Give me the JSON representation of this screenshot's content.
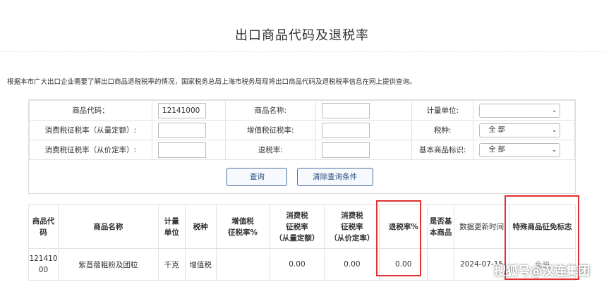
{
  "page": {
    "title": "出口商品代码及退税率",
    "intro": "根据本市广大出口企业需要了解出口商品退税税率的情况，国家税务总局上海市税务局现将出口商品代码及退税税率信息在网上提供查询。"
  },
  "form": {
    "code_label": "商品代码：",
    "code_value": "12141000",
    "name_label": "商品名称:",
    "name_value": "",
    "unit_label": "计量单位:",
    "unit_value": "",
    "cons_qty_label": "消费税征税率（从量定额）:",
    "cons_qty_value": "",
    "vat_label": "增值税征税率:",
    "vat_value": "",
    "tax_type_label": "税种:",
    "tax_type_value": "全 部",
    "cons_val_label": "消费税征税率（从价定率）:",
    "cons_val_value": "",
    "refund_label": "退税率:",
    "refund_value": "",
    "basic_label": "基本商品标识:",
    "basic_value": "全 部",
    "query_button": "查询",
    "clear_button": "清除查询条件"
  },
  "table": {
    "headers": {
      "code_1": "商品代",
      "code_2": "码",
      "name": "商品名称",
      "unit_1": "计量",
      "unit_2": "单位",
      "tax_type": "税种",
      "vat_1": "增值税",
      "vat_2": "征税率%",
      "cq_1": "消费税",
      "cq_2": "征税率",
      "cq_3": "（从量定额）",
      "cv_1": "消费税",
      "cv_2": "征税率",
      "cv_3": "（从价定率）",
      "refund": "退税率%",
      "basic_1": "是否基",
      "basic_2": "本商品",
      "updated": "数据更新时间",
      "special": "特殊商品征免标志"
    },
    "row": {
      "code_1": "121410",
      "code_2": "00",
      "name": "紫苜蓿粗粉及团粒",
      "unit": "千克",
      "tax_type": "增值税",
      "vat": "",
      "cons_qty": "0.00",
      "cons_val": "0.00",
      "refund": "0.00",
      "basic": "",
      "updated": "2024-07-15",
      "special": "免税"
    }
  },
  "watermark": "搜狐号@汉连集团",
  "colors": {
    "highlight": "#e03131",
    "button_border": "#4a6fa5",
    "grid": "#e2e2e2"
  }
}
